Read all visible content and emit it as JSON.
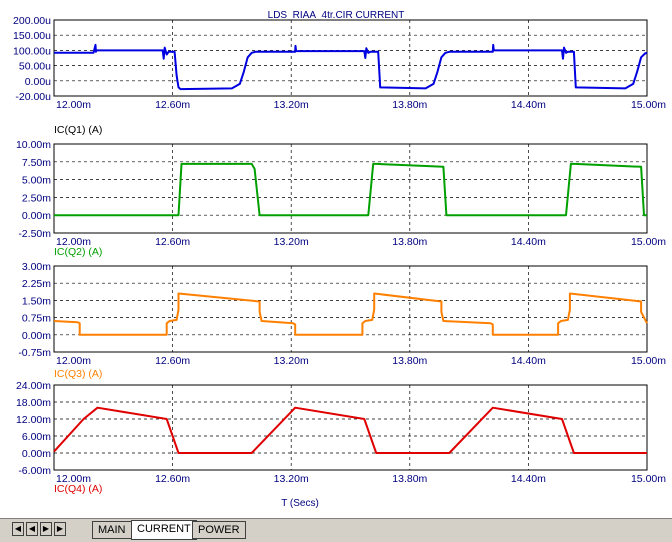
{
  "window_title": "LDS_RIAA_4tr.CIR CURRENT",
  "x_axis_label": "T (Secs)",
  "tabs": [
    {
      "label": "MAIN",
      "active": false
    },
    {
      "label": "CURRENT",
      "active": true
    },
    {
      "label": "POWER",
      "active": false
    }
  ],
  "nav_buttons": [
    "first",
    "prev",
    "next",
    "last"
  ],
  "colors": {
    "q1": "#0000e0",
    "q2": "#00a000",
    "q3": "#ff8000",
    "q4": "#e00000",
    "tick": "#000080",
    "grid": "#606060"
  },
  "chart_data": [
    {
      "type": "line",
      "label": "IC(Q1) (A)",
      "color": "#0000e0",
      "xlim": [
        0.012,
        0.015
      ],
      "x_ticks": [
        "12.00m",
        "12.60m",
        "13.20m",
        "13.80m",
        "14.40m",
        "15.00m"
      ],
      "ylim": [
        -2e-05,
        0.0002
      ],
      "y_ticks": [
        "200.00u",
        "150.00u",
        "100.00u",
        "50.00u",
        "0.00u",
        "-20.00u"
      ],
      "series": [
        {
          "x": [
            0.012,
            0.0122,
            0.01221,
            0.012212,
            0.012215,
            0.01255,
            0.012555,
            0.01256,
            0.01257,
            0.01258,
            0.01261,
            0.01262,
            0.01263,
            0.01264,
            0.0129,
            0.01294,
            0.01296,
            0.01298,
            0.013,
            0.01302,
            0.01322,
            0.013222,
            0.013225,
            0.01357,
            0.013575,
            0.01358,
            0.01359,
            0.0136,
            0.01364,
            0.01365,
            0.01388,
            0.01392,
            0.01394,
            0.01396,
            0.01398,
            0.014,
            0.01422,
            0.014222,
            0.014225,
            0.01457,
            0.014575,
            0.01458,
            0.01459,
            0.0146,
            0.01463,
            0.01464,
            0.01489,
            0.01493,
            0.01495,
            0.01497,
            0.01499,
            0.015
          ],
          "y": [
            0.000105,
            0.000105,
            0.000128,
            0.000108,
            0.000112,
            0.000112,
            8.8e-05,
            0.00012,
            0.0001,
            0.000108,
            0.000108,
            4e-05,
            5e-06,
            0,
            2e-06,
            1.5e-05,
            5e-05,
            9.2e-05,
            0.000105,
            0.000108,
            0.000108,
            0.000125,
            0.00011,
            0.00011,
            9e-05,
            0.000118,
            0.000105,
            0.000108,
            0.000108,
            5e-06,
            2e-06,
            1.5e-05,
            5e-05,
            9.2e-05,
            0.000105,
            0.000108,
            0.000108,
            0.000128,
            0.000112,
            0.000112,
            8.8e-05,
            0.00012,
            0.000105,
            0.000108,
            0.000108,
            5e-06,
            2e-06,
            1.5e-05,
            5e-05,
            9.2e-05,
            0.000103,
            0.000105
          ]
        }
      ]
    },
    {
      "type": "line",
      "label": "IC(Q2) (A)",
      "color": "#00a000",
      "xlim": [
        0.012,
        0.015
      ],
      "x_ticks": [
        "12.00m",
        "12.60m",
        "13.20m",
        "13.80m",
        "14.40m",
        "15.00m"
      ],
      "ylim": [
        -2.5,
        10
      ],
      "y_ticks": [
        "10.00m",
        "7.50m",
        "5.00m",
        "2.50m",
        "0.00m",
        "-2.50m"
      ],
      "series": [
        {
          "x": [
            0.012,
            0.0126,
            0.01263,
            0.012645,
            0.013,
            0.013015,
            0.01304,
            0.0132,
            0.01359,
            0.013615,
            0.013635,
            0.01397,
            0.013985,
            0.01401,
            0.0144,
            0.01459,
            0.014615,
            0.014635,
            0.01497,
            0.014985,
            0.015
          ],
          "y": [
            0,
            0,
            0,
            7.2,
            7.2,
            6.5,
            0,
            0,
            0,
            7.2,
            7.2,
            6.8,
            0,
            0,
            0,
            0,
            7.2,
            7.2,
            6.8,
            0,
            0
          ]
        }
      ]
    },
    {
      "type": "line",
      "label": "IC(Q3) (A)",
      "color": "#ff8000",
      "xlim": [
        0.012,
        0.015
      ],
      "x_ticks": [
        "12.00m",
        "12.60m",
        "13.20m",
        "13.80m",
        "14.40m",
        "15.00m"
      ],
      "ylim": [
        -0.75,
        3
      ],
      "y_ticks": [
        "3.00m",
        "2.25m",
        "1.50m",
        "0.75m",
        "0.00m",
        "-0.75m"
      ],
      "series": [
        {
          "x": [
            0.012,
            0.01212,
            0.01213,
            0.01213,
            0.01257,
            0.01257,
            0.012585,
            0.01262,
            0.01263,
            0.01263,
            0.01304,
            0.01304,
            0.01305,
            0.01321,
            0.01322,
            0.01322,
            0.01356,
            0.01356,
            0.013575,
            0.01361,
            0.01362,
            0.01362,
            0.01396,
            0.01396,
            0.01397,
            0.01421,
            0.01422,
            0.01422,
            0.01455,
            0.01455,
            0.014565,
            0.0146,
            0.01461,
            0.01461,
            0.01497,
            0.01497,
            0.015
          ],
          "y": [
            0.6,
            0.55,
            0.5,
            0,
            0,
            0.5,
            0.6,
            0.65,
            1.1,
            1.8,
            1.45,
            1.0,
            0.6,
            0.5,
            0.45,
            0,
            0,
            0.5,
            0.6,
            0.65,
            1.1,
            1.8,
            1.45,
            1.0,
            0.6,
            0.5,
            0.45,
            0,
            0,
            0.5,
            0.6,
            0.65,
            1.1,
            1.8,
            1.45,
            1.0,
            0.5
          ]
        }
      ]
    },
    {
      "type": "line",
      "label": "IC(Q4) (A)",
      "color": "#e00000",
      "xlim": [
        0.012,
        0.015
      ],
      "x_ticks": [
        "12.00m",
        "12.60m",
        "13.20m",
        "13.80m",
        "14.40m",
        "15.00m"
      ],
      "ylim": [
        -6,
        24
      ],
      "y_ticks": [
        "24.00m",
        "18.00m",
        "12.00m",
        "6.00m",
        "0.00m",
        "-6.00m"
      ],
      "series": [
        {
          "x": [
            0.012,
            0.01215,
            0.01222,
            0.01257,
            0.01263,
            0.013,
            0.01322,
            0.01357,
            0.01363,
            0.014,
            0.01422,
            0.01457,
            0.01463,
            0.015
          ],
          "y": [
            0.5,
            12,
            16,
            12,
            0,
            0,
            16,
            12,
            0,
            0,
            16,
            12,
            0,
            0
          ]
        }
      ]
    }
  ]
}
